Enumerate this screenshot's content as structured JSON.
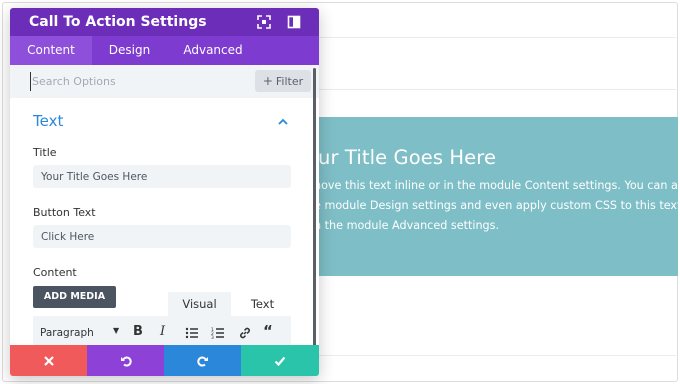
{
  "preview": {
    "cta_title": "our Title Goes Here",
    "cta_body": [
      "nove this text inline or in the module Content settings. You can also",
      "e module Design settings and even apply custom CSS to this text",
      "n the module Advanced settings."
    ],
    "cta_color": "#7ebec6"
  },
  "modal": {
    "title": "Call To Action Settings",
    "header_icons": [
      "expand-icon",
      "sidebar-layout-icon"
    ],
    "tabs": [
      {
        "label": "Content",
        "active": true
      },
      {
        "label": "Design",
        "active": false
      },
      {
        "label": "Advanced",
        "active": false
      }
    ],
    "search": {
      "placeholder": "Search Options",
      "filter_label": "Filter"
    },
    "section": {
      "title": "Text",
      "expanded": true
    },
    "fields": {
      "title_label": "Title",
      "title_value": "Your Title Goes Here",
      "button_label": "Button Text",
      "button_value": "Click Here",
      "content_label": "Content"
    },
    "editor": {
      "add_media": "ADD MEDIA",
      "tab_visual": "Visual",
      "tab_text": "Text",
      "format_select": "Paragraph"
    },
    "footer_colors": {
      "cancel": "#f05a5a",
      "undo": "#8d41d6",
      "redo": "#2b87da",
      "save": "#29c4a9"
    },
    "colors": {
      "header": "#6c2eb9",
      "tabs": "#7d3bcf",
      "accent": "#2b87da"
    }
  }
}
